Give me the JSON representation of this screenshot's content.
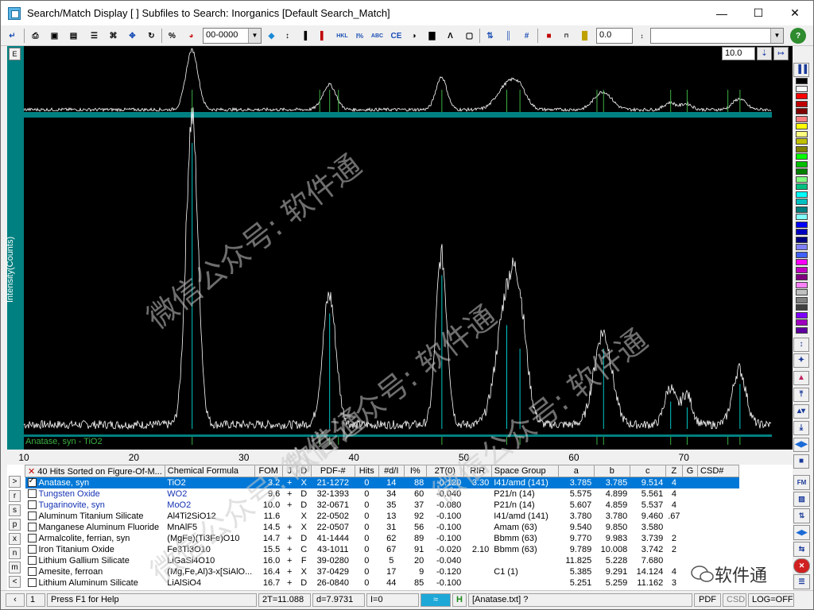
{
  "window": {
    "title": "Search/Match Display [ ] Subfiles to Search: Inorganics [Default Search_Match]",
    "minimize": "—",
    "maximize": "☐",
    "close": "✕"
  },
  "toolbar": {
    "pattern_combo": "00-0000",
    "value_combo": "0.0",
    "search_combo": "",
    "zoom_value": "10.0"
  },
  "plot": {
    "ylabel": "Intensity(Counts)",
    "phase_label": "Anatase, syn - TiO2",
    "mini_button": "E"
  },
  "chart_data": {
    "type": "line",
    "title": "",
    "xlabel": "",
    "ylabel": "Intensity(Counts)",
    "xlim": [
      10,
      78
    ],
    "x_ticks": [
      "10",
      "20",
      "30",
      "40",
      "50",
      "60",
      "70"
    ],
    "peaks_2theta": [
      25.3,
      37.8,
      48.0,
      53.9,
      55.1,
      62.7,
      68.8,
      70.3,
      75.1
    ],
    "reference_lines": [
      25.3,
      36.9,
      37.8,
      38.6,
      48.0,
      53.9,
      55.1,
      62.1,
      62.7,
      68.8,
      70.3,
      74.0,
      75.1
    ]
  },
  "list_header": {
    "hits_title": "40 Hits Sorted on Figure-Of-M...",
    "columns": [
      "Chemical Formula",
      "FOM",
      "J",
      "D",
      "PDF-#",
      "Hits",
      "#d/I",
      "I%",
      "2T(0)",
      "RIR",
      "Space Group",
      "a",
      "b",
      "c",
      "Z",
      "G",
      "CSD#"
    ]
  },
  "side_letters": [
    ">",
    "r",
    "s",
    "p",
    "x",
    "n",
    "m",
    "<"
  ],
  "rows": [
    {
      "name": "Anatase, syn",
      "formula": "TiO2",
      "fom": "3.2",
      "j": "+",
      "d": "X",
      "pdf": "21-1272",
      "hits": "0",
      "dI": "14",
      "ip": "88",
      "t0": "-0.120",
      "rir": "3.30",
      "sg": "I41/amd (141)",
      "a": "3.785",
      "b": "3.785",
      "c": "9.514",
      "z": "4",
      "checked": true,
      "sel": true,
      "blue": false
    },
    {
      "name": "Tungsten Oxide",
      "formula": "WO2",
      "fom": "9.6",
      "j": "+",
      "d": "D",
      "pdf": "32-1393",
      "hits": "0",
      "dI": "34",
      "ip": "60",
      "t0": "-0.040",
      "rir": "",
      "sg": "P21/n (14)",
      "a": "5.575",
      "b": "4.899",
      "c": "5.561",
      "z": "4",
      "checked": false,
      "sel": false,
      "blue": true
    },
    {
      "name": "Tugarinovite, syn",
      "formula": "MoO2",
      "fom": "10.0",
      "j": "+",
      "d": "D",
      "pdf": "32-0671",
      "hits": "0",
      "dI": "35",
      "ip": "37",
      "t0": "-0.080",
      "rir": "",
      "sg": "P21/n (14)",
      "a": "5.607",
      "b": "4.859",
      "c": "5.537",
      "z": "4",
      "checked": false,
      "sel": false,
      "blue": true
    },
    {
      "name": "Aluminum Titanium Silicate",
      "formula": "Al4Ti2SiO12",
      "fom": "11.6",
      "j": "",
      "d": "X",
      "pdf": "22-0502",
      "hits": "0",
      "dI": "13",
      "ip": "92",
      "t0": "-0.100",
      "rir": "",
      "sg": "I41/amd (141)",
      "a": "3.780",
      "b": "3.780",
      "c": "9.460",
      "z": ".67",
      "checked": false,
      "sel": false,
      "blue": false
    },
    {
      "name": "Manganese Aluminum Fluoride",
      "formula": "MnAlF5",
      "fom": "14.5",
      "j": "+",
      "d": "X",
      "pdf": "22-0507",
      "hits": "0",
      "dI": "31",
      "ip": "56",
      "t0": "-0.100",
      "rir": "",
      "sg": "Amam (63)",
      "a": "9.540",
      "b": "9.850",
      "c": "3.580",
      "z": "",
      "checked": false,
      "sel": false,
      "blue": false
    },
    {
      "name": "Armalcolite, ferrian, syn",
      "formula": "(MgFe)(Ti3Fe)O10",
      "fom": "14.7",
      "j": "+",
      "d": "D",
      "pdf": "41-1444",
      "hits": "0",
      "dI": "62",
      "ip": "89",
      "t0": "-0.100",
      "rir": "",
      "sg": "Bbmm (63)",
      "a": "9.770",
      "b": "9.983",
      "c": "3.739",
      "z": "2",
      "checked": false,
      "sel": false,
      "blue": false
    },
    {
      "name": "Iron Titanium Oxide",
      "formula": "Fe3Ti3O10",
      "fom": "15.5",
      "j": "+",
      "d": "C",
      "pdf": "43-1011",
      "hits": "0",
      "dI": "67",
      "ip": "91",
      "t0": "-0.020",
      "rir": "2.10",
      "sg": "Bbmm (63)",
      "a": "9.789",
      "b": "10.008",
      "c": "3.742",
      "z": "2",
      "checked": false,
      "sel": false,
      "blue": false
    },
    {
      "name": "Lithium Gallium Silicate",
      "formula": "LiGaSi4O10",
      "fom": "16.0",
      "j": "+",
      "d": "F",
      "pdf": "39-0280",
      "hits": "0",
      "dI": "5",
      "ip": "20",
      "t0": "-0.040",
      "rir": "",
      "sg": "",
      "a": "11.825",
      "b": "5.228",
      "c": "7.680",
      "z": "",
      "checked": false,
      "sel": false,
      "blue": false
    },
    {
      "name": "Amesite, ferroan",
      "formula": "(Mg,Fe,Al)3-x[SiAlO...",
      "fom": "16.4",
      "j": "+",
      "d": "X",
      "pdf": "37-0429",
      "hits": "0",
      "dI": "17",
      "ip": "9",
      "t0": "-0.120",
      "rir": "",
      "sg": "C1 (1)",
      "a": "5.385",
      "b": "9.291",
      "c": "14.124",
      "z": "4",
      "checked": false,
      "sel": false,
      "blue": false
    },
    {
      "name": "Lithium Aluminum Silicate",
      "formula": "LiAlSiO4",
      "fom": "16.7",
      "j": "+",
      "d": "D",
      "pdf": "26-0840",
      "hits": "0",
      "dI": "44",
      "ip": "85",
      "t0": "-0.100",
      "rir": "",
      "sg": "",
      "a": "5.251",
      "b": "5.259",
      "c": "11.162",
      "z": "3",
      "checked": false,
      "sel": false,
      "blue": false
    }
  ],
  "status": {
    "page": "1",
    "help": "Press F1 for Help",
    "twotheta": "2T=11.088",
    "d": "d=7.9731",
    "i": "I=0",
    "h": "H",
    "file": "[Anatase.txt] ?",
    "pdf": "PDF",
    "csd": "CSD",
    "log": "LOG=OFF"
  },
  "watermark": {
    "text1": "微信公众号: 软件通",
    "logo_text": "软件通"
  },
  "colors": {
    "plot_bg": "#000000",
    "plot_trace": "#ffffff",
    "peak_marker": "#00c8c8",
    "ref_line": "#3cb043",
    "strip_teal": "#008080",
    "selection": "#0078d7"
  }
}
